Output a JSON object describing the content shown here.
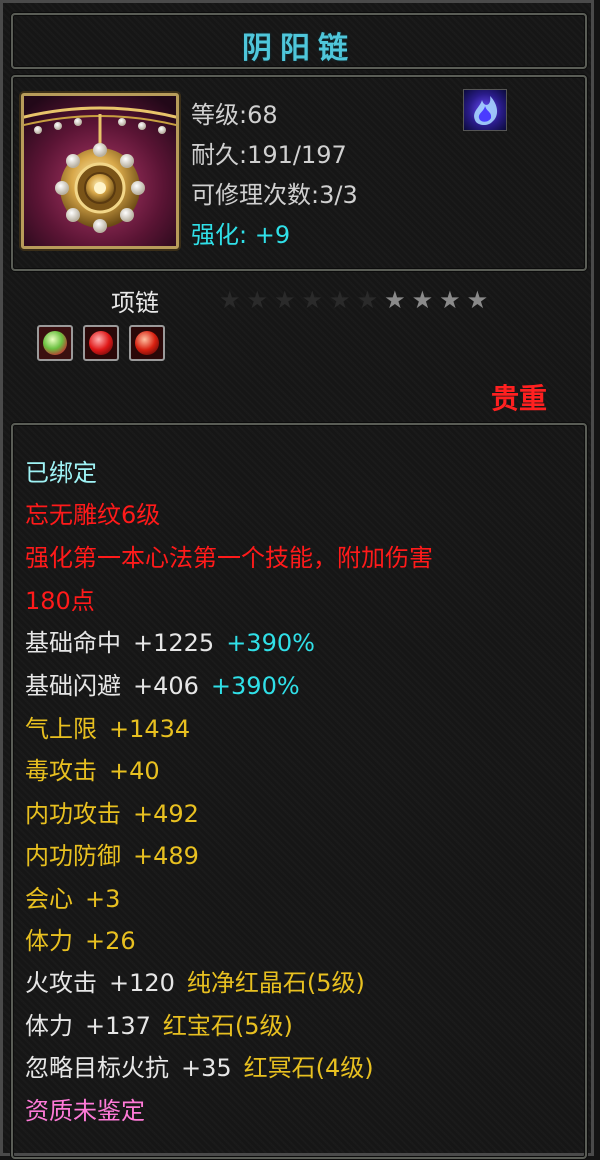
{
  "item": {
    "name": "阴阳链",
    "level": "等级:68",
    "durability": "耐久:191/197",
    "repair": "可修理次数:3/3",
    "enhance_label": "强化:",
    "enhance_value": "+9",
    "type": "项链",
    "rarity": "贵重",
    "stars_total": 10,
    "stars_lit": 4
  },
  "icons": {
    "item": "necklace-icon",
    "skill": "blue-flame-icon",
    "gems": [
      "green-gem-icon",
      "red-gem-icon",
      "red-gem-icon"
    ]
  },
  "colors": {
    "title": "#4fc6da",
    "enhance": "#30e0e8",
    "rarity": "#ff2020",
    "attribute": "#e8c020",
    "special": "#ff1a1a",
    "quality": "#ff7ad8"
  },
  "stats": {
    "bound": "已绑定",
    "engraving": "忘无雕纹6级",
    "skill_line1": "强化第一本心法第一个技能，附加伤害",
    "skill_line2": "180点",
    "rows": [
      {
        "label": "基础命中",
        "value": "+1225",
        "bonus": "+390%"
      },
      {
        "label": "基础闪避",
        "value": "+406",
        "bonus": "+390%"
      },
      {
        "label": "气上限",
        "value": "+1434"
      },
      {
        "label": "毒攻击",
        "value": "+40"
      },
      {
        "label": "内功攻击",
        "value": "+492"
      },
      {
        "label": "内功防御",
        "value": "+489"
      },
      {
        "label": "会心",
        "value": "+3"
      },
      {
        "label": "体力",
        "value": "+26"
      }
    ],
    "gem_rows": [
      {
        "label": "火攻击",
        "value": "+120",
        "gem": "纯净红晶石(5级)"
      },
      {
        "label": "体力",
        "value": "+137",
        "gem": "红宝石(5级)"
      },
      {
        "label": "忽略目标火抗",
        "value": "+35",
        "gem": "红冥石(4级)"
      }
    ],
    "quality": "资质未鉴定"
  }
}
